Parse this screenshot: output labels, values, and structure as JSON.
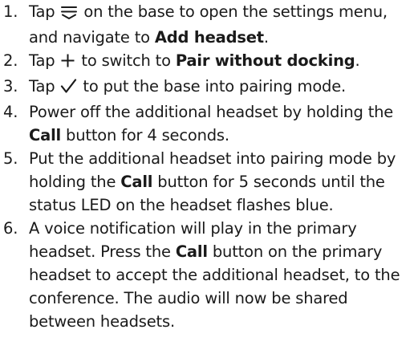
{
  "steps": [
    {
      "number": "1.",
      "segments": [
        {
          "kind": "text",
          "value": "Tap "
        },
        {
          "kind": "icon",
          "icon": "menu-icon"
        },
        {
          "kind": "text",
          "value": " on the base to open the settings menu, and navigate to "
        },
        {
          "kind": "bold",
          "value": "Add headset"
        },
        {
          "kind": "text",
          "value": "."
        }
      ]
    },
    {
      "number": "2.",
      "segments": [
        {
          "kind": "text",
          "value": "Tap "
        },
        {
          "kind": "icon",
          "icon": "plus-icon"
        },
        {
          "kind": "text",
          "value": " to switch to "
        },
        {
          "kind": "bold",
          "value": "Pair without docking"
        },
        {
          "kind": "text",
          "value": "."
        }
      ]
    },
    {
      "number": "3.",
      "segments": [
        {
          "kind": "text",
          "value": "Tap "
        },
        {
          "kind": "icon",
          "icon": "checkmark-icon"
        },
        {
          "kind": "text",
          "value": " to put the base into pairing mode."
        }
      ]
    },
    {
      "number": "4.",
      "segments": [
        {
          "kind": "text",
          "value": "Power off the additional headset by holding the "
        },
        {
          "kind": "bold",
          "value": "Call"
        },
        {
          "kind": "text",
          "value": " button for 4 seconds."
        }
      ]
    },
    {
      "number": "5.",
      "segments": [
        {
          "kind": "text",
          "value": "Put the additional headset into pairing mode by holding the "
        },
        {
          "kind": "bold",
          "value": "Call"
        },
        {
          "kind": "text",
          "value": " button for 5 seconds until the status LED on the headset flashes blue."
        }
      ]
    },
    {
      "number": "6.",
      "segments": [
        {
          "kind": "text",
          "value": "A voice notification will play in the primary headset. Press the "
        },
        {
          "kind": "bold",
          "value": "Call"
        },
        {
          "kind": "text",
          "value": " button on the primary headset to accept the additional headset, to the conference. The audio will now be shared between headsets."
        }
      ]
    }
  ]
}
